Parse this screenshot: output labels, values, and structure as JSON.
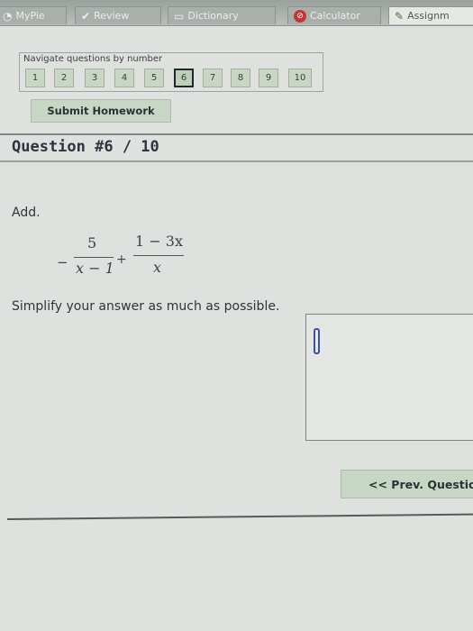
{
  "tabs": [
    {
      "label": "MyPie",
      "icon": "pie-icon"
    },
    {
      "label": "Review",
      "icon": "checkmark-icon"
    },
    {
      "label": "Dictionary",
      "icon": "book-icon"
    },
    {
      "label": "Calculator",
      "icon": "calculator-icon"
    },
    {
      "label": "Assignm",
      "icon": "pencil-icon"
    }
  ],
  "navigator": {
    "label": "Navigate questions by number",
    "questions": [
      "1",
      "2",
      "3",
      "4",
      "5",
      "6",
      "7",
      "8",
      "9",
      "10"
    ],
    "current": "6"
  },
  "submit_label": "Submit Homework",
  "question": {
    "title": "Question #6 / 10",
    "instruction": "Add.",
    "expression": {
      "sign": "−",
      "frac1_num": "5",
      "frac1_den": "x − 1",
      "op": "+",
      "frac2_num": "1 − 3x",
      "frac2_den": "x"
    },
    "prompt": "Simplify your answer as much as possible."
  },
  "prev_label": "<< Prev. Questio"
}
